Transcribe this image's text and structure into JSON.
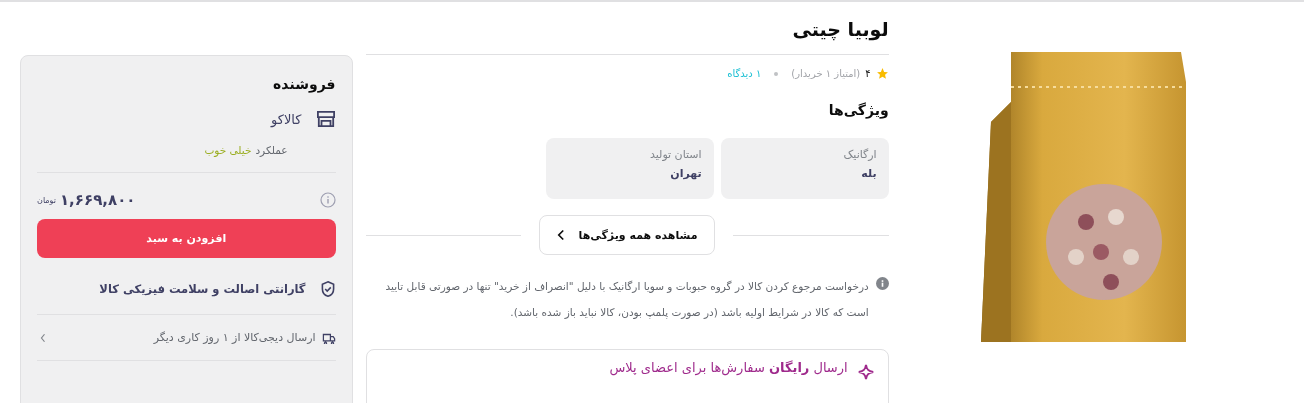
{
  "product": {
    "title": "لوبیا چیتی",
    "rating": "۴",
    "rating_note": "(امتیاز ۱ خریدار)",
    "comments": "۱ دیدگاه"
  },
  "features": {
    "title": "ویژگی‌ها",
    "items": [
      {
        "label": "ارگانیک",
        "value": "بله"
      },
      {
        "label": "استان تولید",
        "value": "تهران"
      }
    ],
    "more_button": "مشاهده همه ویژگی‌ها"
  },
  "notice": "درخواست مرجوع کردن کالا در گروه حبوبات و سویا ارگانیک با دلیل \"انصراف از خرید\" تنها در صورتی قابل تایید است که کالا در شرایط اولیه باشد (در صورت پلمپ بودن، کالا نباید باز شده باشد).",
  "plus_banner": "ارسال **رایگان** سفارش‌ها برای اعضای پلاس",
  "seller": {
    "heading": "فروشنده",
    "name": "کالاکو",
    "performance_label": "عملکرد",
    "performance_value": "خیلی خوب",
    "price": "۱,۶۶۹,۸۰۰",
    "currency": "تومان",
    "add_to_cart": "افزودن به سبد",
    "guarantee": "گارانتی اصالت و سلامت فیزیکی کالا",
    "shipping": "ارسال دیجی‌کالا از ۱ روز کاری دیگر"
  }
}
